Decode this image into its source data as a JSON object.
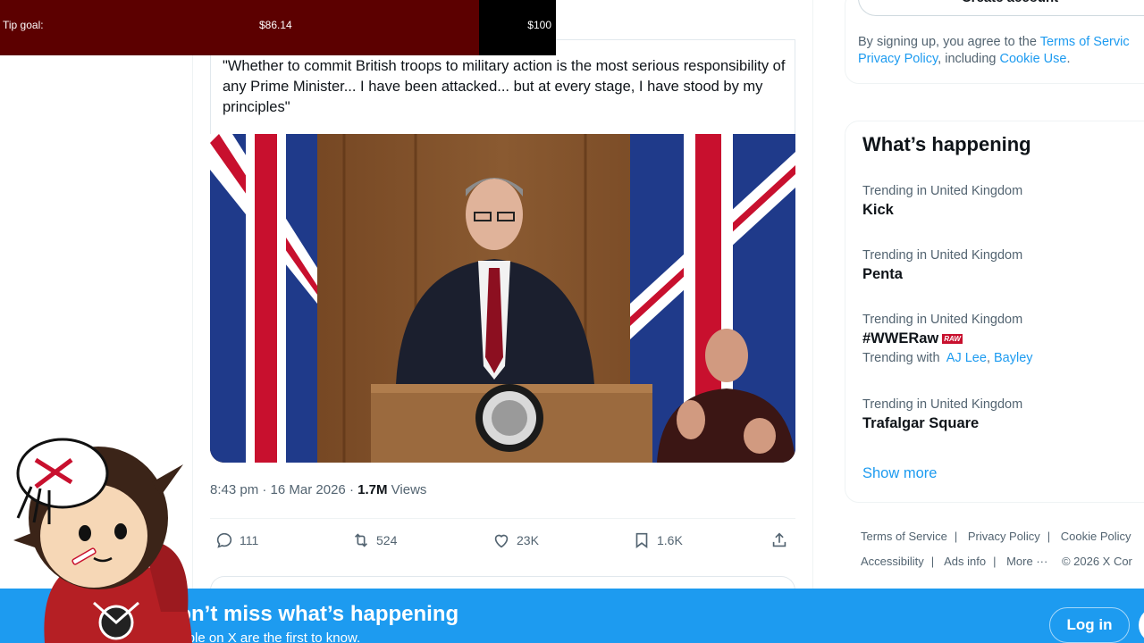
{
  "tip_goal": {
    "label": "Tip goal:",
    "current": "$86.14",
    "target": "$100",
    "progress": 0.8614,
    "fill_color": "#5c0000"
  },
  "tweet": {
    "quote_text": "\"Whether to commit British troops to military action is the most serious responsibility of any Prime Minister... I have been attacked... but at every stage, I have stood by my principles\"",
    "time": "8:43 pm",
    "date": "16 Mar 2026",
    "views_count": "1.7M",
    "views_label": "Views",
    "actions": {
      "replies": "111",
      "reposts": "524",
      "likes": "23K",
      "bookmarks": "1.6K"
    }
  },
  "sidebar": {
    "create_account": "Create account",
    "legal": {
      "prefix": "By signing up, you agree to the ",
      "terms": "Terms of Servic",
      "privacy": "Privacy Policy",
      "middle": ", including ",
      "cookie": "Cookie Use",
      "suffix": "."
    },
    "happening_title": "What’s happening",
    "trends": [
      {
        "context": "Trending in United Kingdom",
        "name": "Kick"
      },
      {
        "context": "Trending in United Kingdom",
        "name": "Penta"
      },
      {
        "context": "Trending in United Kingdom",
        "name": "#WWERaw",
        "badge": "RAW",
        "with_label": "Trending with",
        "with_1": "AJ Lee",
        "with_2": "Bayley"
      },
      {
        "context": "Trending in United Kingdom",
        "name": "Trafalgar Square"
      }
    ],
    "show_more": "Show more",
    "footer": {
      "terms": "Terms of Service",
      "privacy": "Privacy Policy",
      "cookie": "Cookie Policy",
      "accessibility": "Accessibility",
      "ads": "Ads info",
      "more": "More ···",
      "copyright": "© 2026 X Cor"
    }
  },
  "banner": {
    "title": "Don’t miss what’s happening",
    "subtitle": "People on X are the first to know.",
    "login": "Log in"
  },
  "colors": {
    "accent": "#1d9bf0",
    "text_primary": "#0f1419",
    "text_secondary": "#536471"
  }
}
